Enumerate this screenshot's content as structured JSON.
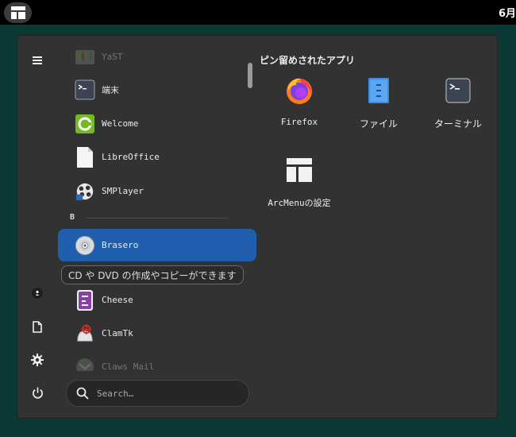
{
  "topbar": {
    "clock": "6月"
  },
  "sidebar": {
    "items": [
      {
        "icon": "hamburger-menu-icon"
      },
      {
        "icon": "user-icon"
      },
      {
        "icon": "document-icon"
      },
      {
        "icon": "settings-gear-icon"
      },
      {
        "icon": "power-icon"
      }
    ]
  },
  "applist": {
    "apps_top": [
      {
        "label": "YaST",
        "icon": "yast-icon"
      },
      {
        "label": "端末",
        "icon": "terminal-icon"
      },
      {
        "label": "Welcome",
        "icon": "opensuse-welcome-icon"
      },
      {
        "label": "LibreOffice",
        "icon": "libreoffice-icon"
      },
      {
        "label": "SMPlayer",
        "icon": "smplayer-icon"
      }
    ],
    "category": "B",
    "apps_b": [
      {
        "label": "Brasero",
        "icon": "brasero-disc-icon",
        "selected": true
      },
      {
        "label": "Cheese",
        "icon": "cheese-icon"
      },
      {
        "label": "ClamTk",
        "icon": "clamtk-icon"
      },
      {
        "label": "Claws Mail",
        "icon": "claws-mail-icon"
      }
    ],
    "tooltip": "CD や DVD の作成やコピーができます"
  },
  "search": {
    "placeholder": "Search…"
  },
  "pinned": {
    "title": "ピン留めされたアプリ",
    "items": [
      {
        "label": "Firefox",
        "icon": "firefox-icon"
      },
      {
        "label": "ファイル",
        "icon": "files-icon"
      },
      {
        "label": "ターミナル",
        "icon": "terminal-icon"
      },
      {
        "label": "ArcMenuの設定",
        "icon": "arcmenu-settings-icon"
      }
    ]
  },
  "colors": {
    "panel_bg": "#323232",
    "selected": "#1f5fae",
    "desktop": "#0b3a35"
  }
}
